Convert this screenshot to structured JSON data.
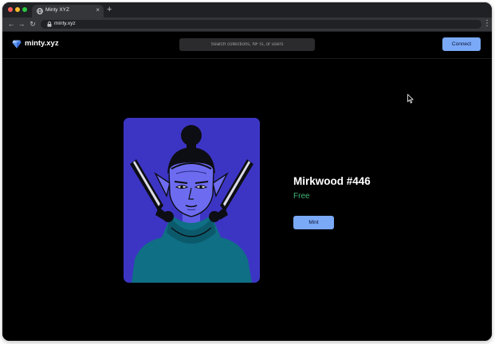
{
  "browser": {
    "tab": {
      "title": "Minty XYZ",
      "close_label": "×"
    },
    "new_tab_label": "+",
    "nav": {
      "back": "←",
      "forward": "→",
      "reload": "↻"
    },
    "url": "minty.xyz",
    "menu_label": "⋮"
  },
  "header": {
    "logo_text": "minty.xyz",
    "search": {
      "placeholder": "Search collections, NFTs, or users",
      "value": ""
    },
    "connect_label": "Connect"
  },
  "nft": {
    "title": "Mirkwood #446",
    "price": "Free",
    "mint_label": "Mint",
    "image_icon": "elf-portrait-illustration"
  },
  "colors": {
    "page_background": "#000000",
    "accent": "#7aa9f7",
    "price_green": "#3fb678",
    "art_background": "#3c35c4"
  }
}
